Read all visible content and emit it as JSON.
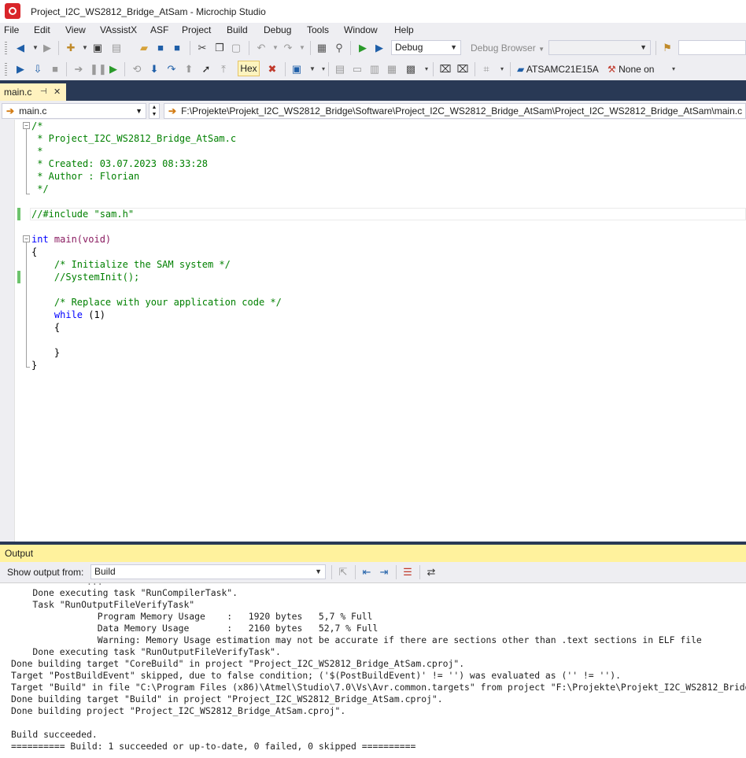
{
  "window": {
    "title": "Project_I2C_WS2812_Bridge_AtSam - Microchip Studio"
  },
  "menu": [
    "File",
    "Edit",
    "View",
    "VAssistX",
    "ASF",
    "Project",
    "Build",
    "Debug",
    "Tools",
    "Window",
    "Help"
  ],
  "toolbar": {
    "config_value": "Debug",
    "debug_browser_label": "Debug Browser",
    "hex_label": "Hex",
    "device_label": "ATSAMC21E15A",
    "tool_label": "None on"
  },
  "tab": {
    "label": "main.c"
  },
  "navbar": {
    "file_combo": "main.c",
    "path": "F:\\Projekte\\Projekt_I2C_WS2812_Bridge\\Software\\Project_I2C_WS2812_Bridge_AtSam\\Project_I2C_WS2812_Bridge_AtSam\\main.c"
  },
  "code": {
    "l1": "/*",
    "l2": " * Project_I2C_WS2812_Bridge_AtSam.c",
    "l3": " *",
    "l4": " * Created: 03.07.2023 08:33:28",
    "l5": " * Author : Florian",
    "l6": " */",
    "l7": "//#include \"sam.h\"",
    "l8_kw": "int",
    "l8_rest": " main(void)",
    "l9": "{",
    "l10": "    /* Initialize the SAM system */",
    "l11": "    //SystemInit();",
    "l12": "    /* Replace with your application code */",
    "l13_kw": "    while",
    "l13_rest": " (1)",
    "l14": "    {",
    "l15": "    }",
    "l16": "}"
  },
  "output": {
    "title": "Output",
    "show_from_label": "Show output from:",
    "source": "Build",
    "lines": [
      "    Done executing task \"RunCompilerTask\".",
      "    Task \"RunOutputFileVerifyTask\"",
      "                Program Memory Usage    :   1920 bytes   5,7 % Full",
      "                Data Memory Usage       :   2160 bytes   52,7 % Full",
      "                Warning: Memory Usage estimation may not be accurate if there are sections other than .text sections in ELF file",
      "    Done executing task \"RunOutputFileVerifyTask\".",
      "Done building target \"CoreBuild\" in project \"Project_I2C_WS2812_Bridge_AtSam.cproj\".",
      "Target \"PostBuildEvent\" skipped, due to false condition; ('$(PostBuildEvent)' != '') was evaluated as ('' != '').",
      "Target \"Build\" in file \"C:\\Program Files (x86)\\Atmel\\Studio\\7.0\\Vs\\Avr.common.targets\" from project \"F:\\Projekte\\Projekt_I2C_WS2812_Bridge\\Software\\Project_I2C_WS2812_Bridge_AtSam\\Project_I2C_WS2812_Bridge_AtSam.cproj\" (entry point):",
      "Done building target \"Build\" in project \"Project_I2C_WS2812_Bridge_AtSam.cproj\".",
      "Done building project \"Project_I2C_WS2812_Bridge_AtSam.cproj\".",
      "",
      "Build succeeded.",
      "========== Build: 1 succeeded or up-to-date, 0 failed, 0 skipped =========="
    ]
  }
}
